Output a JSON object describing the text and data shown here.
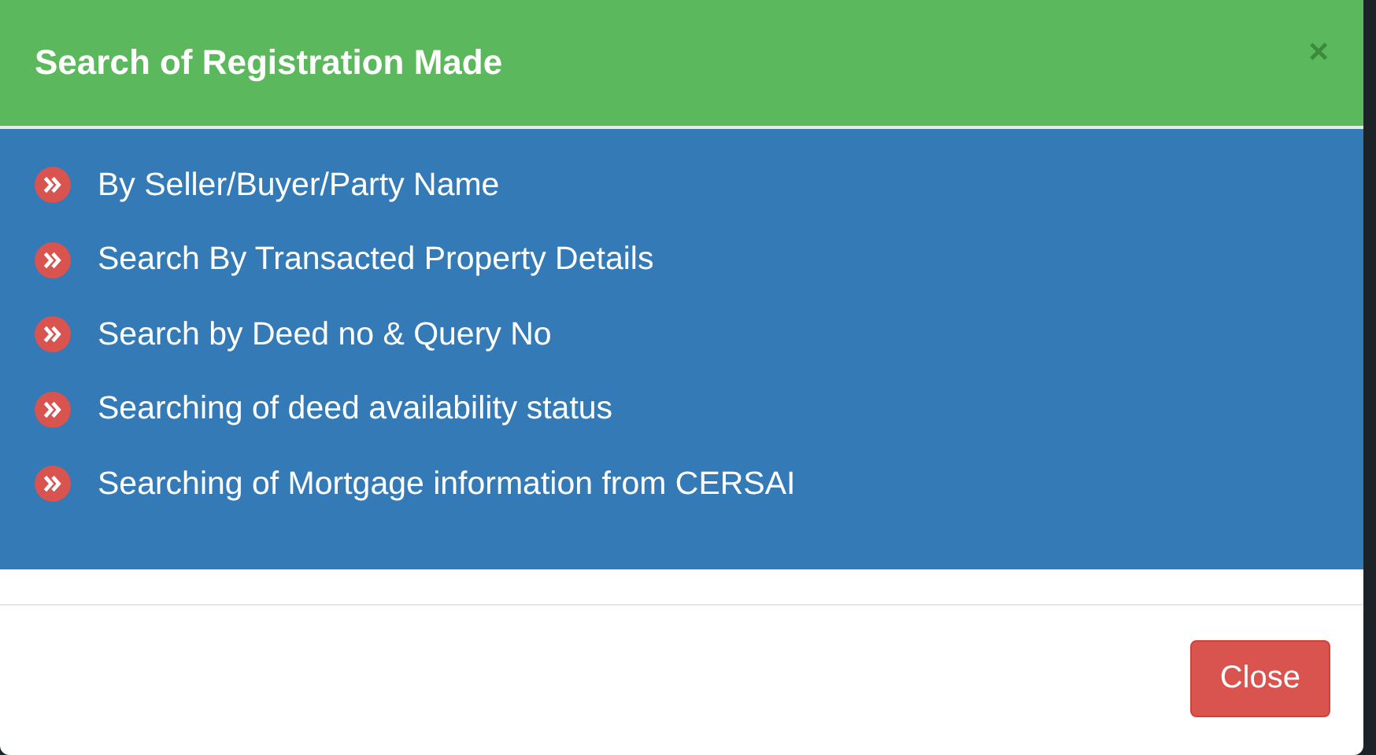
{
  "dialog": {
    "title": "Search of Registration Made",
    "close_symbol": "×"
  },
  "items": [
    {
      "label": "By Seller/Buyer/Party Name"
    },
    {
      "label": "Search By Transacted Property Details"
    },
    {
      "label": "Search by Deed no & Query No"
    },
    {
      "label": "Searching of deed availability status"
    },
    {
      "label": "Searching of Mortgage information from CERSAI"
    }
  ],
  "buttons": [
    {
      "label": "Close"
    }
  ]
}
